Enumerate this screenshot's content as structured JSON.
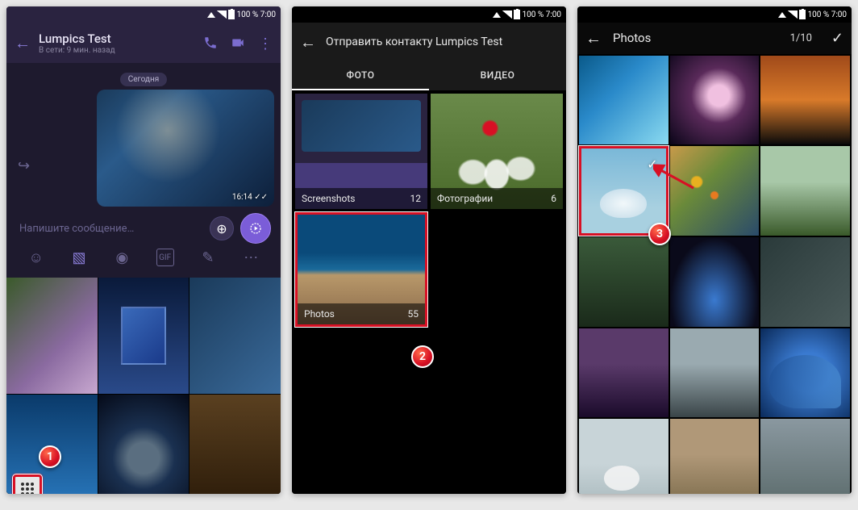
{
  "status_bar": {
    "battery_text": "100 % 7:00"
  },
  "screen1": {
    "title": "Lumpics Test",
    "subtitle": "В сети: 9 мин. назад",
    "date_label": "Сегодня",
    "message_time": "16:14 ✓✓",
    "input_placeholder": "Напишите сообщение…"
  },
  "screen2": {
    "title": "Отправить контакту Lumpics Test",
    "tabs": {
      "photo": "ФОТО",
      "video": "ВИДЕО"
    },
    "albums": [
      {
        "name": "Screenshots",
        "count": "12"
      },
      {
        "name": "Фотографии",
        "count": "6"
      },
      {
        "name": "Photos",
        "count": "55"
      }
    ]
  },
  "screen3": {
    "title": "Photos",
    "counter": "1/10"
  },
  "annotations": {
    "b1": "1",
    "b2": "2",
    "b3": "3"
  }
}
